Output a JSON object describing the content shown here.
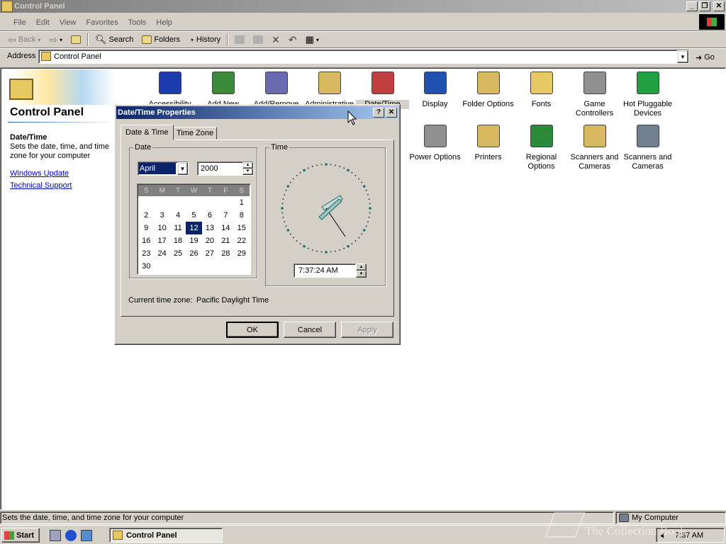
{
  "window": {
    "title": "Control Panel"
  },
  "menu": [
    "File",
    "Edit",
    "View",
    "Favorites",
    "Tools",
    "Help"
  ],
  "toolbar": {
    "back": "Back",
    "search": "Search",
    "folders": "Folders",
    "history": "History"
  },
  "address": {
    "label": "Address",
    "value": "Control Panel",
    "go": "Go"
  },
  "left": {
    "heading": "Control Panel",
    "item_title": "Date/Time",
    "item_desc": "Sets the date, time, and time zone for your computer",
    "links": [
      "Windows Update",
      "Technical Support"
    ]
  },
  "items": [
    {
      "label": "Accessibility",
      "icon": "accessibility-icon",
      "color": "#1c3cab"
    },
    {
      "label": "Add New",
      "icon": "add-hardware-icon",
      "color": "#3a8a3a"
    },
    {
      "label": "Add/Remove",
      "icon": "add-remove-programs-icon",
      "color": "#6a6ab0"
    },
    {
      "label": "Administrative",
      "icon": "admin-tools-icon",
      "color": "#d8b860"
    },
    {
      "label": "Date/Time",
      "icon": "date-time-icon",
      "color": "#c04040"
    },
    {
      "label": "Display",
      "icon": "display-icon",
      "color": "#2050b0"
    },
    {
      "label": "Folder Options",
      "icon": "folder-options-icon",
      "color": "#d8b860"
    },
    {
      "label": "Fonts",
      "icon": "fonts-icon",
      "color": "#e8c860"
    },
    {
      "label": "Game Controllers",
      "icon": "game-controllers-icon",
      "color": "#909090"
    },
    {
      "label": "Hot Pluggable Devices",
      "icon": "hot-pluggable-icon",
      "color": "#20a040"
    },
    {
      "label": "Power Options",
      "icon": "power-options-icon",
      "color": "#909090"
    },
    {
      "label": "Printers",
      "icon": "printers-icon",
      "color": "#d8b860"
    },
    {
      "label": "Regional Options",
      "icon": "regional-options-icon",
      "color": "#2a8a3a"
    },
    {
      "label": "Scanners and Cameras",
      "icon": "scanners-cameras-icon",
      "color": "#d8b860"
    },
    {
      "label": "Scanners and Cameras",
      "icon": "scanners-cameras-icon",
      "color": "#708090"
    }
  ],
  "dialog": {
    "title": "Date/Time Properties",
    "tabs": [
      "Date & Time",
      "Time Zone"
    ],
    "date_group": "Date",
    "time_group": "Time",
    "month": "April",
    "year": "2000",
    "weekdays": [
      "S",
      "M",
      "T",
      "W",
      "T",
      "F",
      "S"
    ],
    "weeks": [
      [
        "",
        "",
        "",
        "",
        "",
        "",
        "1"
      ],
      [
        "2",
        "3",
        "4",
        "5",
        "6",
        "7",
        "8"
      ],
      [
        "9",
        "10",
        "11",
        "12",
        "13",
        "14",
        "15"
      ],
      [
        "16",
        "17",
        "18",
        "19",
        "20",
        "21",
        "22"
      ],
      [
        "23",
        "24",
        "25",
        "26",
        "27",
        "28",
        "29"
      ],
      [
        "30",
        "",
        "",
        "",
        "",
        "",
        ""
      ]
    ],
    "selected_day": "12",
    "time": "7:37:24 AM",
    "timezone_label": "Current time zone:",
    "timezone": "Pacific Daylight Time",
    "ok": "OK",
    "cancel": "Cancel",
    "apply": "Apply"
  },
  "status": {
    "text": "Sets the date, time, and time zone for your computer",
    "zone": "My Computer"
  },
  "taskbar": {
    "start": "Start",
    "task": "Control Panel",
    "clock": "7:37 AM"
  },
  "watermark": "The Collection Book"
}
